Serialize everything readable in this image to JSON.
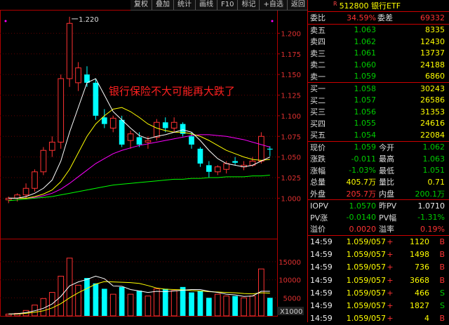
{
  "toolbar": {
    "items": [
      "复权",
      "叠加",
      "统计",
      "画线",
      "F10",
      "标记",
      "+自选",
      "返回"
    ]
  },
  "chart": {
    "annotation": "银行保险不大可能再大跌了",
    "max_label": "1.220",
    "price_ticks": [
      "1.200",
      "1.175",
      "1.150",
      "1.125",
      "1.100",
      "1.075",
      "1.050",
      "1.025",
      "1.000"
    ],
    "volume_ticks": [
      "15000",
      "10000",
      "5000"
    ],
    "volume_unit": "X1000",
    "colors": {
      "up": "#ff3232",
      "down": "#00ffff",
      "ma5": "#ffffff",
      "ma10": "#ffff00",
      "ma20": "#ff00ff",
      "ma60": "#00ff00"
    }
  },
  "chart_data": {
    "type": "candlestick",
    "ylim": [
      0.985,
      1.225
    ],
    "candles": [
      {
        "o": 0.998,
        "h": 1.002,
        "l": 0.994,
        "c": 1.0
      },
      {
        "o": 1.0,
        "h": 1.006,
        "l": 0.996,
        "c": 1.004
      },
      {
        "o": 1.004,
        "h": 1.018,
        "l": 1.0,
        "c": 1.012
      },
      {
        "o": 1.012,
        "h": 1.035,
        "l": 1.008,
        "c": 1.032
      },
      {
        "o": 1.032,
        "h": 1.062,
        "l": 1.028,
        "c": 1.058
      },
      {
        "o": 1.058,
        "h": 1.075,
        "l": 1.05,
        "c": 1.068
      },
      {
        "o": 1.068,
        "h": 1.15,
        "l": 1.06,
        "c": 1.145
      },
      {
        "o": 1.145,
        "h": 1.22,
        "l": 1.135,
        "c": 1.212
      },
      {
        "o": 1.14,
        "h": 1.165,
        "l": 1.13,
        "c": 1.158
      },
      {
        "o": 1.15,
        "h": 1.16,
        "l": 1.135,
        "c": 1.14
      },
      {
        "o": 1.14,
        "h": 1.145,
        "l": 1.095,
        "c": 1.1
      },
      {
        "o": 1.098,
        "h": 1.108,
        "l": 1.085,
        "c": 1.09
      },
      {
        "o": 1.085,
        "h": 1.1,
        "l": 1.08,
        "c": 1.097
      },
      {
        "o": 1.095,
        "h": 1.1,
        "l": 1.062,
        "c": 1.065
      },
      {
        "o": 1.07,
        "h": 1.082,
        "l": 1.06,
        "c": 1.078
      },
      {
        "o": 1.074,
        "h": 1.08,
        "l": 1.062,
        "c": 1.065
      },
      {
        "o": 1.068,
        "h": 1.075,
        "l": 1.06,
        "c": 1.07
      },
      {
        "o": 1.074,
        "h": 1.096,
        "l": 1.07,
        "c": 1.092
      },
      {
        "o": 1.092,
        "h": 1.098,
        "l": 1.08,
        "c": 1.085
      },
      {
        "o": 1.085,
        "h": 1.098,
        "l": 1.08,
        "c": 1.092
      },
      {
        "o": 1.09,
        "h": 1.092,
        "l": 1.075,
        "c": 1.078
      },
      {
        "o": 1.075,
        "h": 1.08,
        "l": 1.06,
        "c": 1.065
      },
      {
        "o": 1.06,
        "h": 1.062,
        "l": 1.038,
        "c": 1.042
      },
      {
        "o": 1.04,
        "h": 1.045,
        "l": 1.025,
        "c": 1.032
      },
      {
        "o": 1.032,
        "h": 1.04,
        "l": 1.028,
        "c": 1.038
      },
      {
        "o": 1.035,
        "h": 1.045,
        "l": 1.03,
        "c": 1.042
      },
      {
        "o": 1.045,
        "h": 1.05,
        "l": 1.04,
        "c": 1.043
      },
      {
        "o": 1.038,
        "h": 1.045,
        "l": 1.034,
        "c": 1.04
      },
      {
        "o": 1.04,
        "h": 1.05,
        "l": 1.038,
        "c": 1.045
      },
      {
        "o": 1.045,
        "h": 1.08,
        "l": 1.042,
        "c": 1.075
      },
      {
        "o": 1.06,
        "h": 1.063,
        "l": 1.051,
        "c": 1.059
      }
    ],
    "ma5": [
      1.0,
      1.0,
      1.002,
      1.006,
      1.012,
      1.022,
      1.045,
      1.08,
      1.11,
      1.14,
      1.145,
      1.125,
      1.105,
      1.095,
      1.085,
      1.076,
      1.072,
      1.075,
      1.077,
      1.08,
      1.083,
      1.08,
      1.07,
      1.058,
      1.048,
      1.042,
      1.04,
      1.038,
      1.04,
      1.045,
      1.05
    ],
    "ma10": [
      1.0,
      1.0,
      1.0,
      1.002,
      1.005,
      1.01,
      1.02,
      1.035,
      1.055,
      1.075,
      1.09,
      1.1,
      1.108,
      1.11,
      1.105,
      1.098,
      1.09,
      1.085,
      1.082,
      1.08,
      1.08,
      1.078,
      1.075,
      1.07,
      1.064,
      1.058,
      1.054,
      1.05,
      1.047,
      1.046,
      1.047
    ],
    "ma20": [
      1.0,
      1.0,
      1.0,
      1.001,
      1.003,
      1.006,
      1.011,
      1.018,
      1.026,
      1.034,
      1.042,
      1.048,
      1.054,
      1.058,
      1.061,
      1.064,
      1.066,
      1.068,
      1.07,
      1.072,
      1.074,
      1.076,
      1.077,
      1.077,
      1.076,
      1.075,
      1.073,
      1.071,
      1.068,
      1.065,
      1.062
    ],
    "ma60": [
      0.997,
      0.998,
      0.999,
      1.0,
      1.001,
      1.002,
      1.004,
      1.006,
      1.008,
      1.01,
      1.012,
      1.014,
      1.016,
      1.017,
      1.018,
      1.019,
      1.02,
      1.021,
      1.022,
      1.023,
      1.023,
      1.024,
      1.024,
      1.025,
      1.025,
      1.026,
      1.026,
      1.026,
      1.027,
      1.027,
      1.028
    ],
    "volume": {
      "ylim": [
        0,
        17500
      ],
      "values": [
        500,
        700,
        1500,
        3000,
        4800,
        6500,
        11000,
        16000,
        8500,
        10500,
        9000,
        7500,
        6000,
        8000,
        6000,
        7000,
        5500,
        7500,
        7500,
        7000,
        8000,
        6500,
        7000,
        5000,
        6000,
        5500,
        5500,
        5000,
        5500,
        13000,
        5000
      ],
      "ma5": [
        500,
        600,
        900,
        1400,
        2100,
        3300,
        5400,
        8300,
        9400,
        10100,
        11000,
        10300,
        8300,
        8200,
        7300,
        6900,
        6500,
        6800,
        6700,
        6900,
        7100,
        7300,
        7300,
        6800,
        6500,
        6000,
        5800,
        5400,
        5500,
        6800,
        6800
      ],
      "ma10": [
        500,
        500,
        700,
        1000,
        1400,
        2200,
        3400,
        5000,
        6400,
        7600,
        8800,
        9500,
        9400,
        9300,
        9200,
        9000,
        8400,
        7700,
        7400,
        7300,
        7200,
        7000,
        6900,
        6700,
        6600,
        6500,
        6400,
        6200,
        6100,
        6400,
        6300
      ]
    }
  },
  "quote": {
    "title": "512800 银行ETF",
    "title_mark": "R",
    "weibi": {
      "label": "委比",
      "value": "34.59%",
      "label2": "委差",
      "value2": "69332"
    },
    "sell": [
      {
        "label": "卖五",
        "price": "1.063",
        "vol": "8335"
      },
      {
        "label": "卖四",
        "price": "1.062",
        "vol": "12430"
      },
      {
        "label": "卖三",
        "price": "1.061",
        "vol": "13737"
      },
      {
        "label": "卖二",
        "price": "1.060",
        "vol": "24188"
      },
      {
        "label": "卖一",
        "price": "1.059",
        "vol": "6860"
      }
    ],
    "buy": [
      {
        "label": "买一",
        "price": "1.058",
        "vol": "30243"
      },
      {
        "label": "买二",
        "price": "1.057",
        "vol": "26586"
      },
      {
        "label": "买三",
        "price": "1.056",
        "vol": "31353"
      },
      {
        "label": "买四",
        "price": "1.055",
        "vol": "24616"
      },
      {
        "label": "买五",
        "price": "1.054",
        "vol": "22084"
      }
    ],
    "stats": [
      [
        {
          "l": "现价",
          "v": "1.059",
          "c": "green"
        },
        {
          "l": "今开",
          "v": "1.062",
          "c": "green"
        }
      ],
      [
        {
          "l": "涨跌",
          "v": "-0.011",
          "c": "green"
        },
        {
          "l": "最高",
          "v": "1.063",
          "c": "green"
        }
      ],
      [
        {
          "l": "涨幅",
          "v": "-1.03%",
          "c": "green"
        },
        {
          "l": "最低",
          "v": "1.051",
          "c": "green"
        }
      ],
      [
        {
          "l": "总量",
          "v": "405.7万",
          "c": "yel"
        },
        {
          "l": "量比",
          "v": "0.71",
          "c": "yel"
        }
      ],
      [
        {
          "l": "外盘",
          "v": "205.7万",
          "c": "red"
        },
        {
          "l": "内盘",
          "v": "200.1万",
          "c": "green"
        }
      ]
    ],
    "iopv": [
      [
        {
          "l": "IOPV",
          "v": "1.0570",
          "c": "green"
        },
        {
          "l": "昨PV",
          "v": "1.0710",
          "c": "white"
        }
      ],
      [
        {
          "l": "PV涨",
          "v": "-0.0140",
          "c": "green"
        },
        {
          "l": "PV幅",
          "v": "-1.31%",
          "c": "green"
        }
      ],
      [
        {
          "l": "溢价",
          "v": "0.0020",
          "c": "red"
        },
        {
          "l": "溢率",
          "v": "0.19%",
          "c": "red"
        }
      ]
    ],
    "ticks": [
      {
        "t": "14:59",
        "p": "1.059/057",
        "s": "+",
        "v": "1120",
        "d": "B"
      },
      {
        "t": "14:59",
        "p": "1.059/057",
        "s": "+",
        "v": "1498",
        "d": "B"
      },
      {
        "t": "14:59",
        "p": "1.059/057",
        "s": "+",
        "v": "736",
        "d": "B"
      },
      {
        "t": "14:59",
        "p": "1.059/057",
        "s": "+",
        "v": "3668",
        "d": "B"
      },
      {
        "t": "14:59",
        "p": "1.059/057",
        "s": "+",
        "v": "466",
        "d": "S"
      },
      {
        "t": "14:59",
        "p": "1.059/057",
        "s": "+",
        "v": "1827",
        "d": "S"
      },
      {
        "t": "14:59",
        "p": "1.059/057",
        "s": "+",
        "v": "4",
        "d": "B"
      }
    ]
  }
}
